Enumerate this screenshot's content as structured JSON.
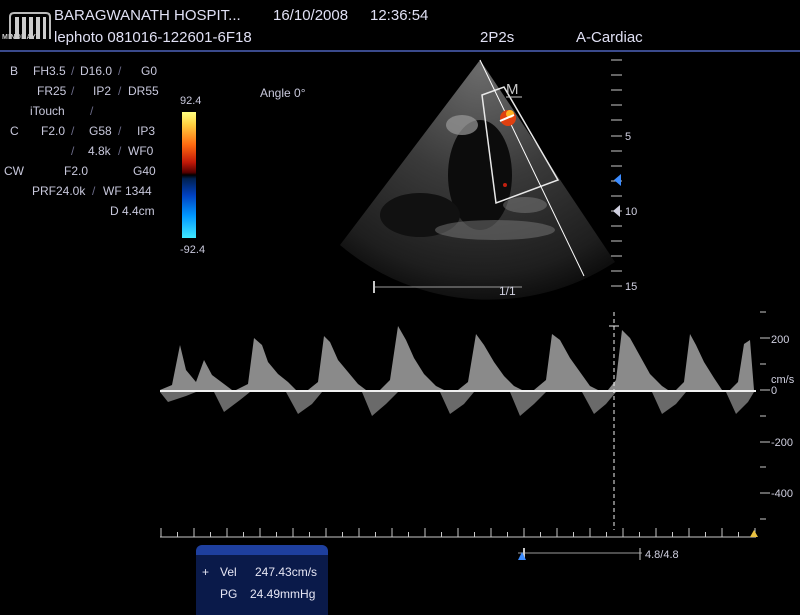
{
  "header": {
    "brand": "MINDRAY",
    "hospital": "BARAGWANATH HOSPIT...",
    "date": "16/10/2008",
    "time": "12:36:54",
    "patient_id": "lephoto 081016-122601-6F18",
    "probe": "2P2s",
    "preset": "A-Cardiac"
  },
  "params": {
    "b_label": "B",
    "b_fh": "FH3.5",
    "b_d": "D16.0",
    "b_g": "G0",
    "b_fr": "FR25",
    "b_ip": "IP2",
    "b_dr": "DR55",
    "b_itouch": "iTouch",
    "c_label": "C",
    "c_f": "F2.0",
    "c_g": "G58",
    "c_ip": "IP3",
    "c_prf": "4.8k",
    "c_wf": "WF0",
    "cw_label": "CW",
    "cw_f": "F2.0",
    "cw_g": "G40",
    "cw_prf": "PRF24.0k",
    "cw_wf": "WF 1344",
    "cw_d": "D 4.4cm"
  },
  "color_scale": {
    "max": "92.4",
    "min": "-92.4"
  },
  "image": {
    "angle": "Angle 0°",
    "frame": "1/1",
    "m_marker": "M",
    "depth_labels": [
      "5",
      "10",
      "15"
    ]
  },
  "doppler": {
    "velocity_labels": [
      "200",
      "0",
      "-200",
      "-400"
    ],
    "unit": "cm/s",
    "sweep": "4.8/4.8"
  },
  "measurement": {
    "vel_symbol": "+",
    "vel_label": "Vel",
    "vel_value": "247.43cm/s",
    "pg_label": "PG",
    "pg_value": "24.49mmHg"
  },
  "colors": {
    "accent": "#3a4a8c",
    "measurement_panel": "#1e3f9e",
    "text": "#d8d8e8"
  }
}
